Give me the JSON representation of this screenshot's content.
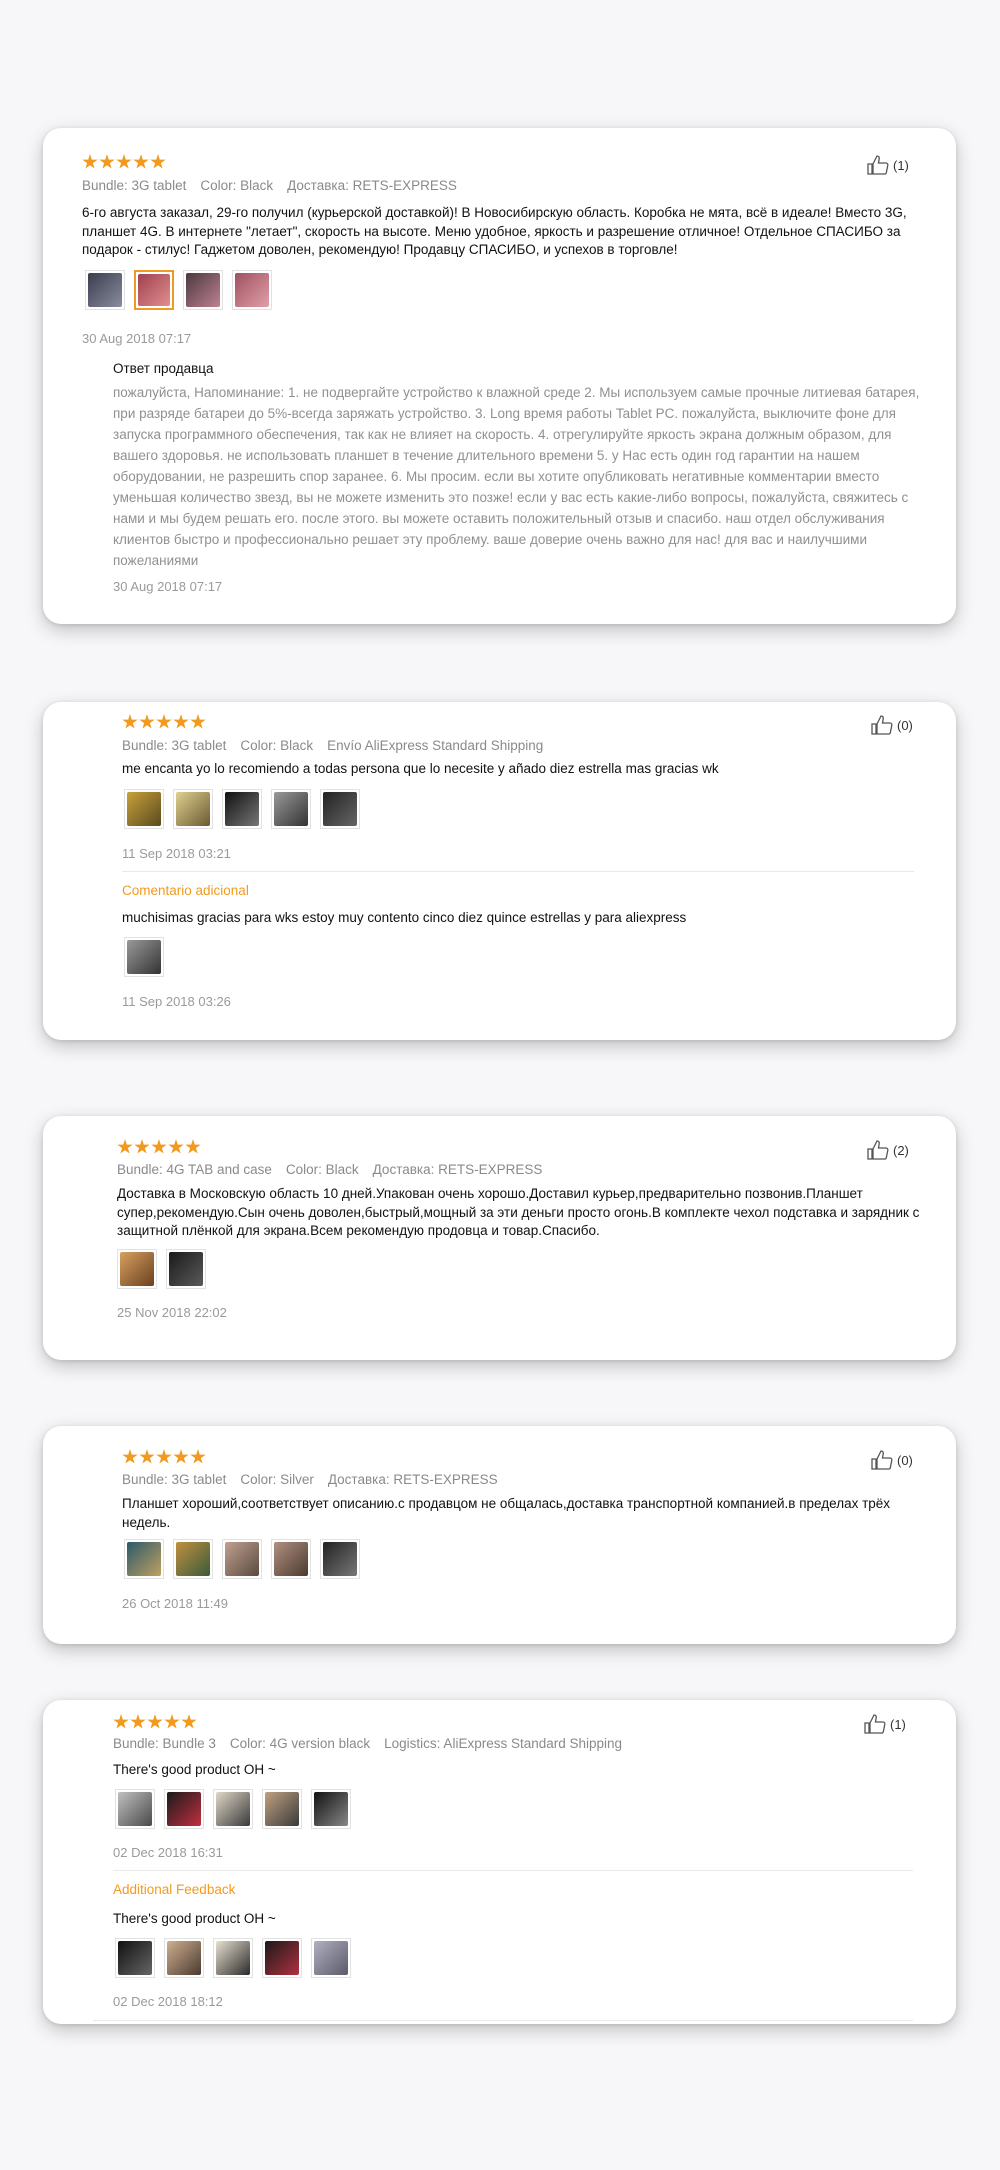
{
  "reviews": [
    {
      "rating": 5,
      "meta": [
        "Bundle: 3G tablet",
        "Color: Black",
        "Доставка: RETS-EXPRESS"
      ],
      "text": "6-го августа заказал, 29-го получил (курьерской доставкой)! В Новосибирскую область. Коробка не мята, всё в идеале! Вместо 3G, планшет 4G. В интернете \"летает\", скорость на высоте. Меню удобное, яркость и разрешение отличное! Отдельное СПАСИБО за подарок - стилус! Гаджетом доволен, рекомендую! Продавцу СПАСИБО, и успехов в торговле!",
      "date": "30 Aug 2018 07:17",
      "likes": "(1)",
      "photo_colors": [
        "#5a5d6e",
        "#c06060",
        "#6a5a60",
        "#c4707a"
      ],
      "seller_reply": {
        "title": "Ответ продавца",
        "text": "пожалуйста, Напоминание: 1. не подвергайте устройство к влажной среде 2. Мы используем самые прочные литиевая батарея, при разряде батареи до 5%-всегда заряжать устройство. 3. Long время работы Tablet PC. пожалуйста, выключите фоне для запуска программного обеспечения, так как не влияет на скорость. 4. отрегулируйте яркость экрана должным образом, для вашего здоровья. не использовать планшет в течение длительного времени 5. у Нас есть один год гарантии на нашем оборудовании, не разрешить спор заранее. 6. Мы просим. если вы хотите опубликовать негативные комментарии вместо уменьшая количество звезд, вы не можете изменить это позже! если у вас есть какие-либо вопросы, пожалуйста, свяжитесь с нами и мы будем решать его. после этого. вы можете оставить положительный отзыв и спасибо. наш отдел обслуживания клиентов быстро и профессионально решает эту проблему. ваше доверие очень важно для нас! для вас и наилучшими пожеланиями",
        "date": "30 Aug 2018 07:17"
      }
    },
    {
      "rating": 5,
      "meta": [
        "Bundle: 3G tablet",
        "Color: Black",
        "Envío AliExpress Standard Shipping"
      ],
      "text": "me encanta yo lo recomiendo a todas persona que lo necesite y añado diez estrella mas gracias wk",
      "date": "11 Sep 2018 03:21",
      "likes": "(0)",
      "photo_colors": [
        "#c9a13a",
        "#d8c070",
        "#2a2a2a",
        "#555555",
        "#333333"
      ],
      "additional": {
        "label": "Comentario adicional",
        "text": "muchisimas gracias para wks estoy muy contento cinco diez quince estrellas y para aliexpress",
        "date": "11 Sep 2018 03:26",
        "photo_colors": [
          "#555555"
        ]
      }
    },
    {
      "rating": 5,
      "meta": [
        "Bundle: 4G TAB and case",
        "Color: Black",
        "Доставка: RETS-EXPRESS"
      ],
      "text": "Доставка в Московскую область 10 дней.Упакован очень хорошо.Доставил курьер,предварительно позвонив.Планшет супер,рекомендую.Сын очень доволен,быстрый,мощный за эти деньги просто огонь.В комплекте чехол подставка и зарядник с защитной плёнкой для экрана.Всем рекомендую продовца и товар.Спасибо.",
      "date": "25 Nov 2018 22:02",
      "likes": "(2)",
      "photo_colors": [
        "#b07a3a",
        "#2c2c2c"
      ]
    },
    {
      "rating": 5,
      "meta": [
        "Bundle: 3G tablet",
        "Color: Silver",
        "Доставка: RETS-EXPRESS"
      ],
      "text": "Планшет хороший,соответствует описанию.с продавцом не общалась,доставка транспортной компанией.в пределах трёх недель.",
      "date": "26 Oct 2018 11:49",
      "likes": "(0)",
      "photo_colors": [
        "#3a6a7a",
        "#8a6a3a",
        "#9a8070",
        "#8a6a5a",
        "#333333"
      ]
    },
    {
      "rating": 5,
      "meta": [
        "Bundle: Bundle 3",
        "Color: 4G version black",
        "Logistics: AliExpress Standard Shipping"
      ],
      "text": "There's good product OH ~",
      "date": "02 Dec 2018 16:31",
      "likes": "(1)",
      "photo_colors": [
        "#7a7a7a",
        "#b03040",
        "#c8b8a0",
        "#8a7a6a",
        "#444444"
      ],
      "additional": {
        "label": "Additional Feedback",
        "text": "There's good product OH ~",
        "date": "02 Dec 2018 18:12",
        "photo_colors": [
          "#333333",
          "#b09070",
          "#6a6a6a",
          "#a03040",
          "#8a8a9a"
        ]
      }
    }
  ]
}
